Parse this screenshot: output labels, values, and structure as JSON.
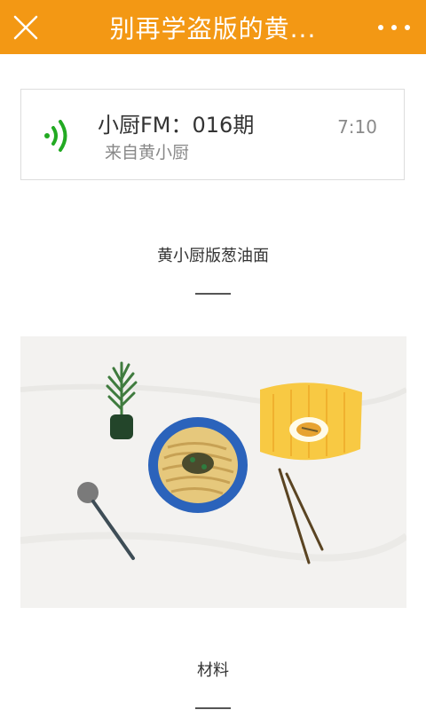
{
  "header": {
    "title": "别再学盗版的黄...",
    "close_icon": "close-icon",
    "more_icon": "more-dots-icon",
    "background": "#f39814"
  },
  "audio": {
    "title": "小厨FM：016期",
    "source": "来自黄小厨",
    "duration": "7:10",
    "icon": "sound-wave-icon",
    "icon_color": "#22aa22"
  },
  "article": {
    "heading1": "黄小厨版葱油面",
    "heading2": "材料"
  }
}
